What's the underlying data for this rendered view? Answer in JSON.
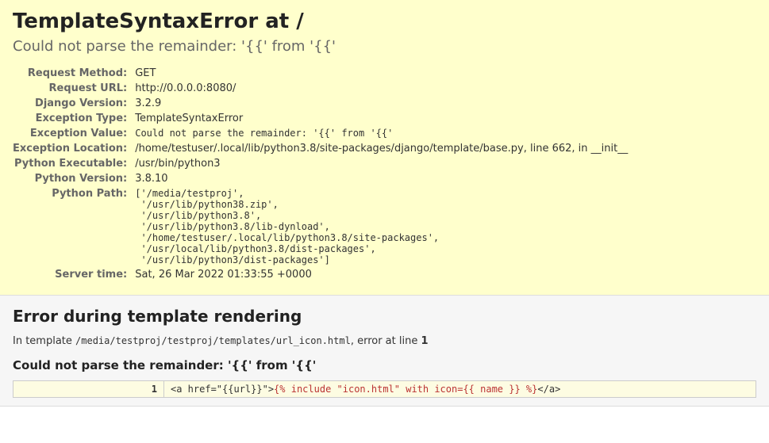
{
  "summary": {
    "title": "TemplateSyntaxError at /",
    "subtitle": "Could not parse the remainder: '{{' from '{{'",
    "rows": {
      "request_method": {
        "label": "Request Method:",
        "value": "GET"
      },
      "request_url": {
        "label": "Request URL:",
        "value": "http://0.0.0.0:8080/"
      },
      "django_version": {
        "label": "Django Version:",
        "value": "3.2.9"
      },
      "exception_type": {
        "label": "Exception Type:",
        "value": "TemplateSyntaxError"
      },
      "exception_value": {
        "label": "Exception Value:",
        "value": "Could not parse the remainder: '{{' from '{{'"
      },
      "exception_location": {
        "label": "Exception Location:",
        "value": "/home/testuser/.local/lib/python3.8/site-packages/django/template/base.py, line 662, in __init__"
      },
      "python_executable": {
        "label": "Python Executable:",
        "value": "/usr/bin/python3"
      },
      "python_version": {
        "label": "Python Version:",
        "value": "3.8.10"
      },
      "python_path": {
        "label": "Python Path:",
        "value": "['/media/testproj',\n '/usr/lib/python38.zip',\n '/usr/lib/python3.8',\n '/usr/lib/python3.8/lib-dynload',\n '/home/testuser/.local/lib/python3.8/site-packages',\n '/usr/local/lib/python3.8/dist-packages',\n '/usr/lib/python3/dist-packages']"
      },
      "server_time": {
        "label": "Server time:",
        "value": "Sat, 26 Mar 2022 01:33:55 +0000"
      }
    }
  },
  "template": {
    "heading": "Error during template rendering",
    "intro_prefix": "In template ",
    "template_path": "/media/testproj/testproj/templates/url_icon.html",
    "intro_mid": ", error at line ",
    "error_line": "1",
    "error_title": "Could not parse the remainder: '{{' from '{{'",
    "source": {
      "lineno": "1",
      "before": "<a href=\"{{url}}\">",
      "highlight": "{% include \"icon.html\" with icon={{ name }} %}",
      "after": "</a>"
    }
  }
}
